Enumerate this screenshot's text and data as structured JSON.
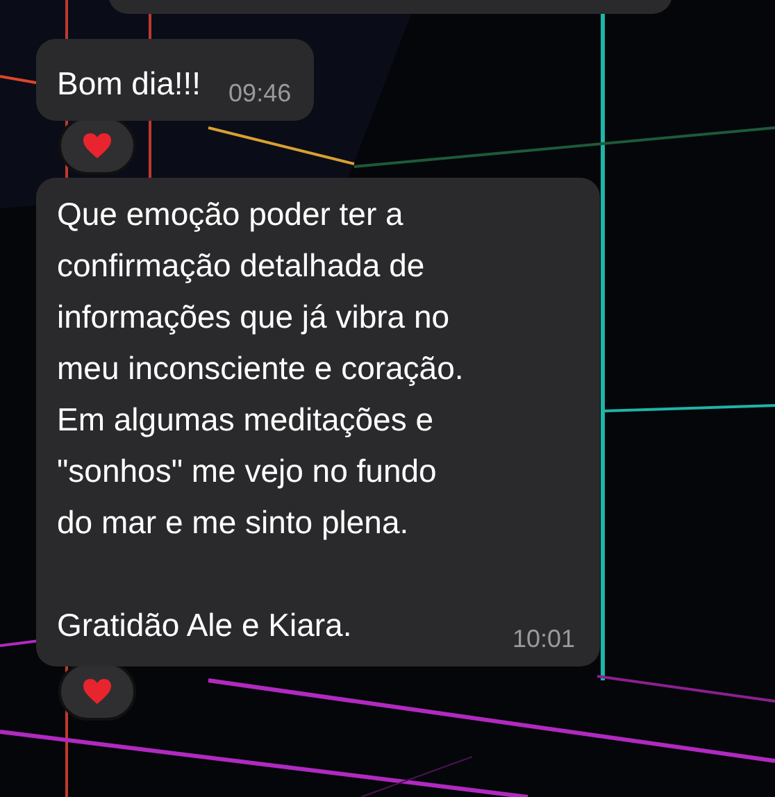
{
  "messages": [
    {
      "kind": "partial"
    },
    {
      "kind": "text",
      "text": "Bom dia!!!",
      "time": "09:46",
      "reaction": {
        "kind": "heart"
      }
    },
    {
      "kind": "text",
      "text": "Que emoção poder ter a\nconfirmação detalhada de\ninformações que já vibra no\nmeu inconsciente e coração.\nEm algumas meditações e\n\"sonhos\" me vejo no fundo\ndo mar e me sinto plena.\n\nGratidão Ale e Kiara.",
      "time": "10:01",
      "reaction": {
        "kind": "heart"
      }
    }
  ]
}
